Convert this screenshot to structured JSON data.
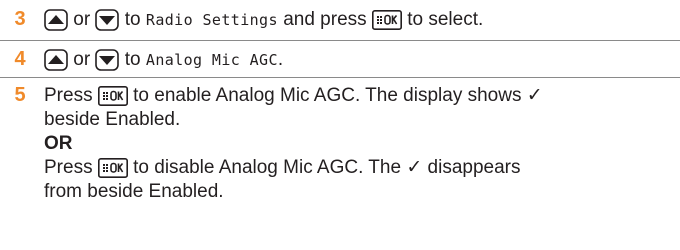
{
  "steps": [
    {
      "number": "3",
      "or_word": "or",
      "to_word": "to",
      "menu_name": "Radio Settings",
      "press_text": "and press",
      "end_text": "to select."
    },
    {
      "number": "4",
      "or_word": "or",
      "to_word": "to",
      "menu_name": "Analog Mic AGC",
      "end_text": "."
    },
    {
      "number": "5",
      "line1_press": "Press",
      "line1_rest": "to enable Analog Mic AGC. The display shows ✓",
      "line2": "beside Enabled.",
      "or_label": "OR",
      "line4_press": "Press",
      "line4_rest": "to disable Analog Mic AGC. The ✓ disappears",
      "line5": "from beside Enabled."
    }
  ],
  "colors": {
    "step_number": "#f08a2a",
    "text": "#231f20",
    "rule": "#8a8a8a"
  },
  "icons": [
    "up-arrow-key-icon",
    "down-arrow-key-icon",
    "menu-ok-key-icon"
  ]
}
